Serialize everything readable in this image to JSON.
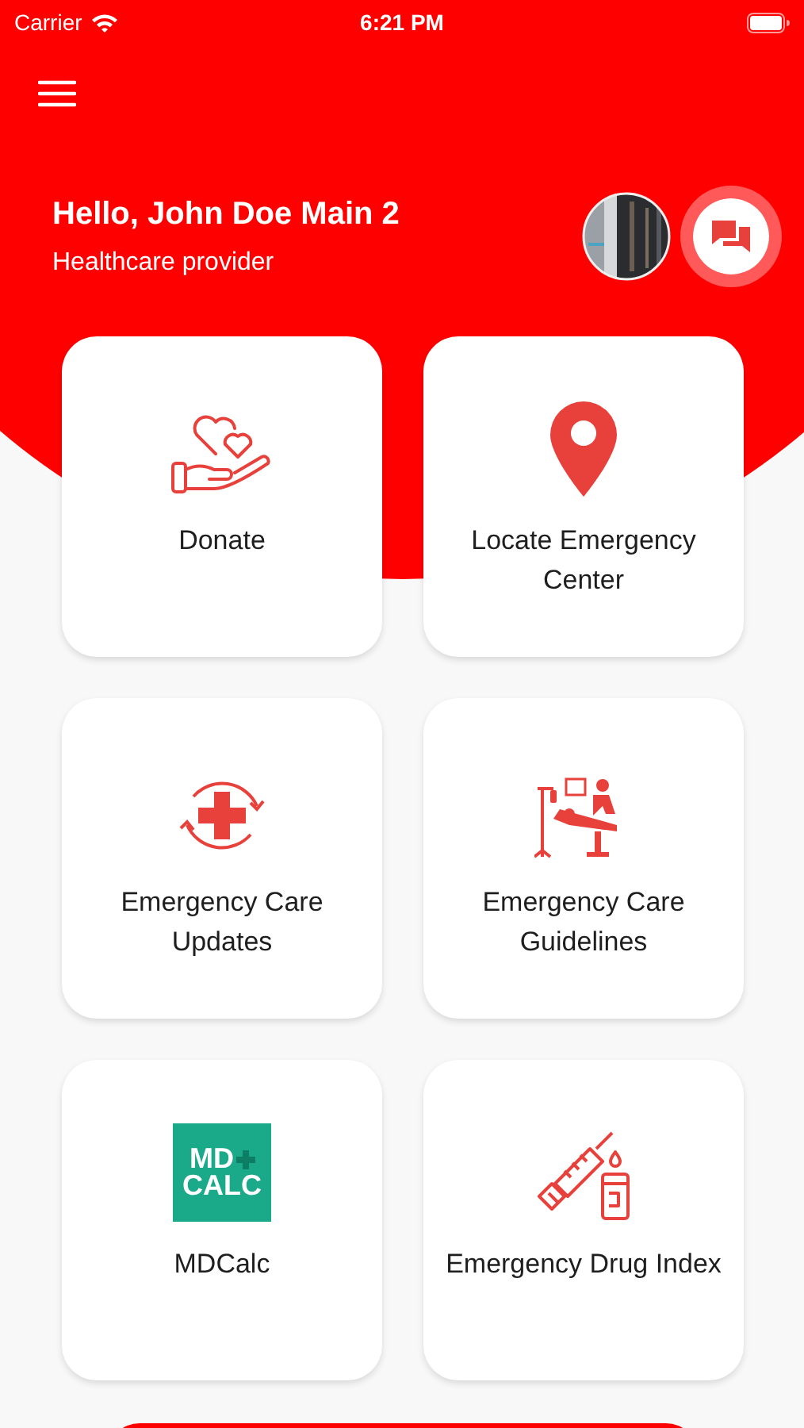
{
  "status_bar": {
    "carrier": "Carrier",
    "time": "6:21 PM"
  },
  "header": {
    "greeting": "Hello, John Doe Main 2",
    "role": "Healthcare provider"
  },
  "tiles": [
    {
      "label": "Donate",
      "kind": "icon"
    },
    {
      "label": "Locate Emergency Center",
      "kind": "icon"
    },
    {
      "label": "Emergency Care Updates",
      "kind": "icon"
    },
    {
      "label": "Emergency Care Guidelines",
      "kind": "icon"
    },
    {
      "label": "MDCalc",
      "kind": "logo",
      "logo_lines": [
        "MD",
        "CALC"
      ]
    },
    {
      "label": "Emergency Drug Index",
      "kind": "icon"
    }
  ]
}
